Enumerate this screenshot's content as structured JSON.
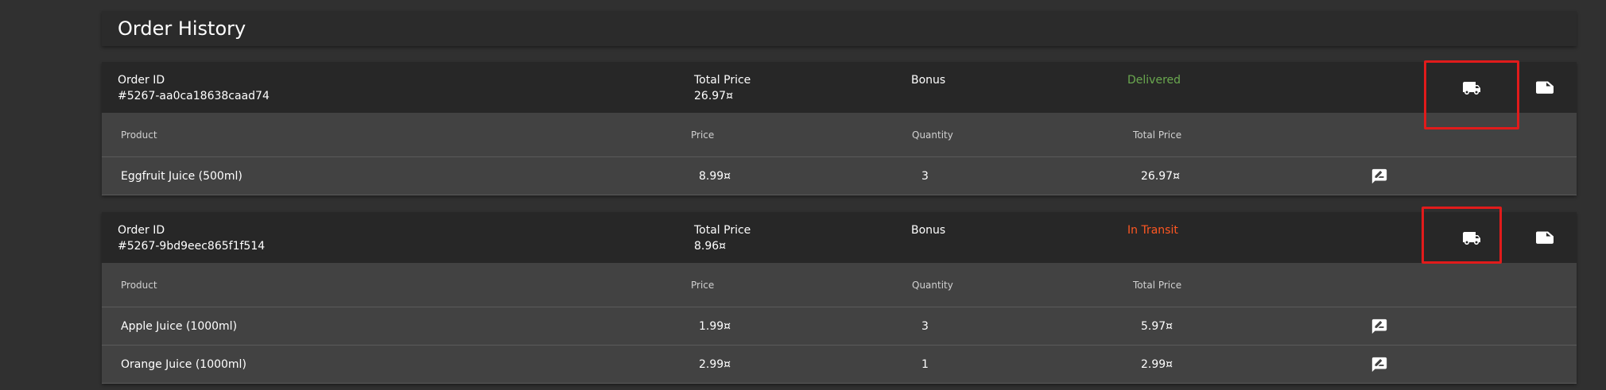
{
  "page_title": "Order History",
  "labels": {
    "order_id": "Order ID",
    "total_price": "Total Price",
    "bonus": "Bonus"
  },
  "table_headers": {
    "product": "Product",
    "price": "Price",
    "quantity": "Quantity",
    "total_price": "Total Price"
  },
  "orders": [
    {
      "id": "#5267-aa0ca18638caad74",
      "total": "26.97¤",
      "bonus": "",
      "status": "Delivered",
      "status_color": "#6aa84f",
      "items": [
        {
          "product": "Eggfruit Juice (500ml)",
          "price": "8.99¤",
          "quantity": "3",
          "total": "26.97¤"
        }
      ]
    },
    {
      "id": "#5267-9bd9eec865f1f514",
      "total": "8.96¤",
      "bonus": "",
      "status": "In Transit",
      "status_color": "#ff5722",
      "items": [
        {
          "product": "Apple Juice (1000ml)",
          "price": "1.99¤",
          "quantity": "3",
          "total": "5.97¤"
        },
        {
          "product": "Orange Juice (1000ml)",
          "price": "2.99¤",
          "quantity": "1",
          "total": "2.99¤"
        }
      ]
    }
  ],
  "icons": {
    "track": "truck-icon",
    "print_label": "label-icon",
    "review": "rate-review-icon"
  },
  "colors": {
    "highlight": "#e11b1b",
    "background": "#303030"
  }
}
